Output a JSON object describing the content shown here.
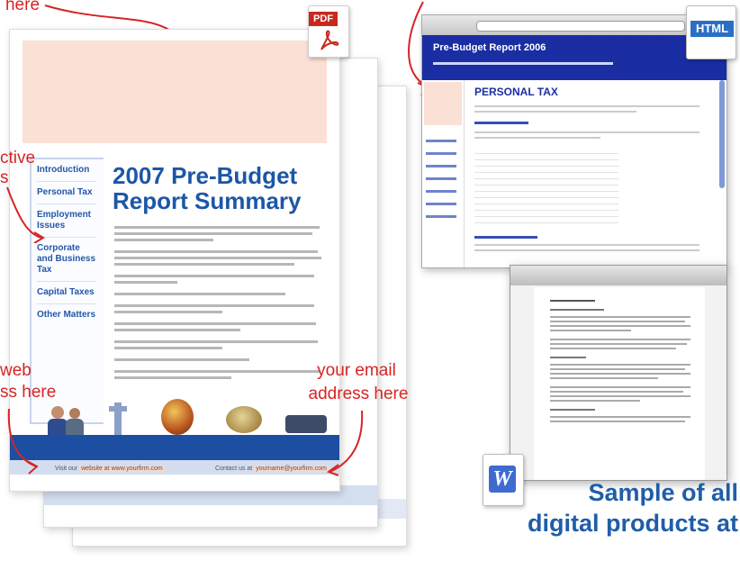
{
  "annotations": {
    "here_top": "here",
    "active_line1": "ctive",
    "active_line2": "s",
    "web_line1": "web",
    "web_line2": "ss here",
    "email_line1": "your email",
    "email_line2": "address here"
  },
  "pdf": {
    "icon_label": "PDF",
    "nav_items": [
      "Introduction",
      "Personal Tax",
      "Employment Issues",
      "Corporate and Business Tax",
      "Capital Taxes",
      "Other Matters"
    ],
    "title": "2007 Pre-Budget Report Summary",
    "footer_left_prefix": "Visit our",
    "footer_left_link": "website at www.yourfirm.com",
    "footer_right_prefix": "Contact us at",
    "footer_right_link": "yourname@yourfirm.com"
  },
  "html_window": {
    "icon_label": "HTML",
    "header_title": "Pre-Budget Report 2006",
    "section_title": "PERSONAL TAX"
  },
  "word_window": {
    "icon_label": "W"
  },
  "caption": {
    "line1": "Sample of all",
    "line2": "digital products at"
  },
  "colors": {
    "annotation_red": "#d82424",
    "brand_blue": "#1c57a6",
    "pink_placeholder": "#fbe0d6"
  }
}
